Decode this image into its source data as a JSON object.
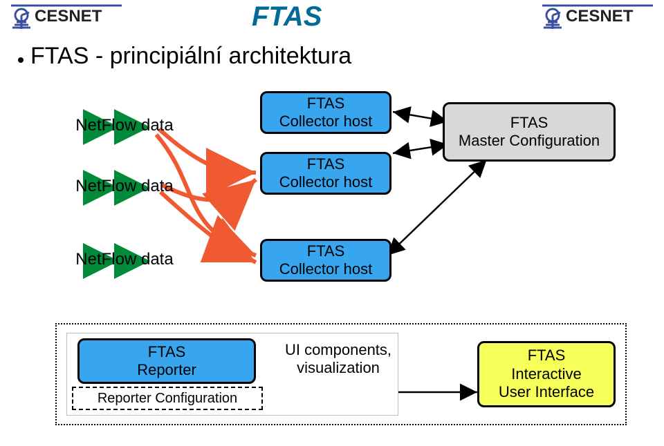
{
  "header": {
    "brand_left": "CESNET",
    "brand_right": "CESNET",
    "page_title": "FTAS"
  },
  "bullet": {
    "text": "FTAS - principiální architektura"
  },
  "labels": {
    "netflow_1": "NetFlow data",
    "netflow_2": "NetFlow data",
    "netflow_3": "NetFlow data",
    "collector_1_line1": "FTAS",
    "collector_1_line2": "Collector host",
    "collector_2_line1": "FTAS",
    "collector_2_line2": "Collector host",
    "collector_3_line1": "FTAS",
    "collector_3_line2": "Collector host",
    "master_line1": "FTAS",
    "master_line2": "Master Configuration",
    "reporter_line1": "FTAS",
    "reporter_line2": "Reporter",
    "reporter_conf": "Reporter Configuration",
    "uicomp_line1": "UI components,",
    "uicomp_line2": "visualization",
    "interactive_line1": "FTAS",
    "interactive_line2": "Interactive",
    "interactive_line3": "User Interface"
  },
  "colors": {
    "title": "#006a98",
    "collector_box": "#38a5ef",
    "master_box": "#d8d8d8",
    "interactive_box": "#f7ff59",
    "arrow_green": "#008a3a",
    "curve_red": "#f05a32"
  }
}
